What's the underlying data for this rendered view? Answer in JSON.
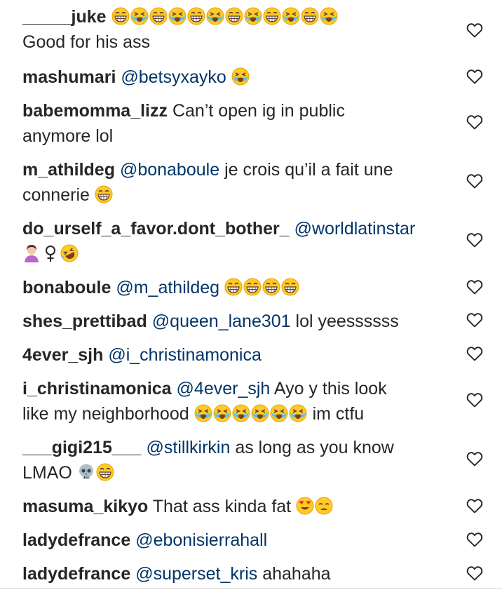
{
  "comments": [
    {
      "username": "_____juke",
      "mention": "",
      "text": "",
      "emojis": [
        "grin",
        "cry",
        "grin",
        "cry",
        "grin",
        "cry",
        "grin",
        "cry",
        "grin",
        "cry",
        "grin",
        "cry"
      ],
      "line2": "Good for his ass",
      "line2_emojis": [],
      "after_emojis": ""
    },
    {
      "username": "mashumari",
      "mention": "@betsyxayko",
      "text": "",
      "emojis": [
        "cry"
      ],
      "line2": "",
      "line2_emojis": [],
      "after_emojis": ""
    },
    {
      "username": "babemomma_lizz",
      "mention": "",
      "text": "Can’t open ig in public",
      "emojis": [],
      "line2": "anymore lol",
      "line2_emojis": [],
      "after_emojis": ""
    },
    {
      "username": "m_athildeg",
      "mention": "@bonaboule",
      "text": "je crois qu’il a fait une",
      "emojis": [],
      "line2": "connerie",
      "line2_emojis": [
        "grin"
      ],
      "after_emojis": ""
    },
    {
      "username": "do_urself_a_favor.dont_bother_",
      "mention": "@worldlatinstar",
      "text": "",
      "emojis": [],
      "line2": "",
      "line2_emojis": [
        "facepalm",
        "female",
        "rofl"
      ],
      "after_emojis": ""
    },
    {
      "username": "bonaboule",
      "mention": "@m_athildeg",
      "text": "",
      "emojis": [
        "grin",
        "grin",
        "grin",
        "grin"
      ],
      "line2": "",
      "line2_emojis": [],
      "after_emojis": ""
    },
    {
      "username": "shes_prettibad",
      "mention": "@queen_lane301",
      "text": "lol yeessssss",
      "emojis": [],
      "line2": "",
      "line2_emojis": [],
      "after_emojis": ""
    },
    {
      "username": "4ever_sjh",
      "mention": "@i_christinamonica",
      "text": "",
      "emojis": [],
      "line2": "",
      "line2_emojis": [],
      "after_emojis": ""
    },
    {
      "username": "i_christinamonica",
      "mention": "@4ever_sjh",
      "text": "Ayo y this look",
      "emojis": [],
      "line2": "like my neighborhood",
      "line2_emojis": [
        "cry",
        "cry",
        "cry",
        "cry",
        "cry",
        "cry"
      ],
      "after_emojis": "im ctfu"
    },
    {
      "username": "___gigi215___",
      "mention": "@stillkirkin",
      "text": "as long as you know",
      "emojis": [],
      "line2": "LMAO",
      "line2_emojis": [
        "skull",
        "grin"
      ],
      "after_emojis": ""
    },
    {
      "username": "masuma_kikyo",
      "mention": "",
      "text": "That ass kinda fat",
      "emojis": [
        "hearteyes",
        "tired"
      ],
      "line2": "",
      "line2_emojis": [],
      "after_emojis": ""
    },
    {
      "username": "ladydefrance",
      "mention": "@ebonisierrahall",
      "text": "",
      "emojis": [],
      "line2": "",
      "line2_emojis": [],
      "after_emojis": ""
    },
    {
      "username": "ladydefrance",
      "mention": "@superset_kris",
      "text": "ahahaha",
      "emojis": [],
      "line2": "",
      "line2_emojis": [],
      "after_emojis": ""
    }
  ],
  "icons": {
    "like": "heart-outline-icon"
  },
  "colors": {
    "text": "#262626",
    "mention": "#003569",
    "heart": "#262626",
    "emoji_face": "#FFCA28"
  }
}
